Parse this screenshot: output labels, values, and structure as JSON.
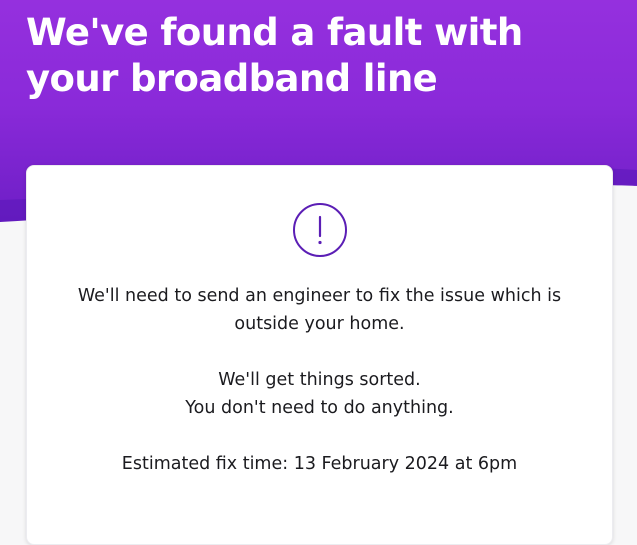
{
  "header": {
    "title": "We've found a fault with your broadband line"
  },
  "card": {
    "icon": "exclamation-circle-icon",
    "message_line_1": "We'll need to send an engineer to fix the issue which is outside your home.",
    "reassurance_line_1": "We'll get things sorted.",
    "reassurance_line_2": "You don't need to do anything.",
    "estimate": "Estimated fix time: 13 February 2024 at 6pm"
  },
  "colors": {
    "brand_purple": "#8a2ad9",
    "icon_purple": "#5b1eb5",
    "background": "#f7f7f8",
    "card": "#ffffff"
  }
}
